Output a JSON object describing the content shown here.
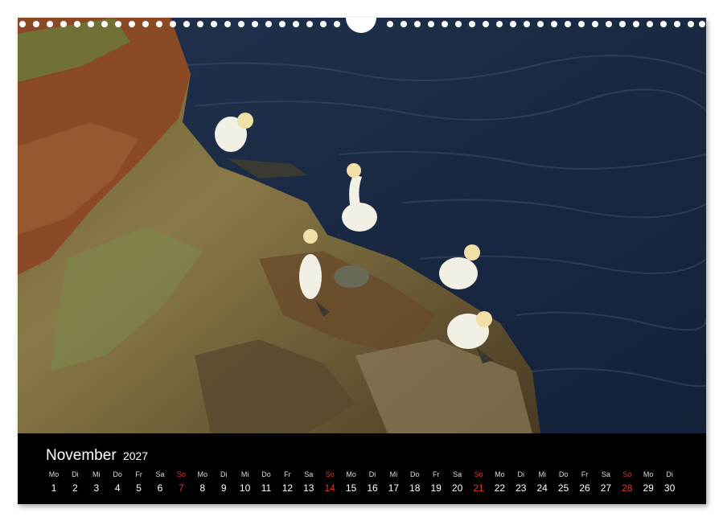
{
  "calendar": {
    "month": "November",
    "year": "2027",
    "days": [
      {
        "wd": "Mo",
        "n": "1"
      },
      {
        "wd": "Di",
        "n": "2"
      },
      {
        "wd": "Mi",
        "n": "3"
      },
      {
        "wd": "Do",
        "n": "4"
      },
      {
        "wd": "Fr",
        "n": "5"
      },
      {
        "wd": "Sa",
        "n": "6"
      },
      {
        "wd": "So",
        "n": "7",
        "sunday": true
      },
      {
        "wd": "Mo",
        "n": "8"
      },
      {
        "wd": "Di",
        "n": "9"
      },
      {
        "wd": "Mi",
        "n": "10"
      },
      {
        "wd": "Do",
        "n": "11"
      },
      {
        "wd": "Fr",
        "n": "12"
      },
      {
        "wd": "Sa",
        "n": "13"
      },
      {
        "wd": "So",
        "n": "14",
        "sunday": true
      },
      {
        "wd": "Mo",
        "n": "15"
      },
      {
        "wd": "Di",
        "n": "16"
      },
      {
        "wd": "Mi",
        "n": "17"
      },
      {
        "wd": "Do",
        "n": "18"
      },
      {
        "wd": "Fr",
        "n": "19"
      },
      {
        "wd": "Sa",
        "n": "20"
      },
      {
        "wd": "So",
        "n": "21",
        "sunday": true
      },
      {
        "wd": "Mo",
        "n": "22"
      },
      {
        "wd": "Di",
        "n": "23"
      },
      {
        "wd": "Mi",
        "n": "24"
      },
      {
        "wd": "Do",
        "n": "25"
      },
      {
        "wd": "Fr",
        "n": "26"
      },
      {
        "wd": "Sa",
        "n": "27"
      },
      {
        "wd": "So",
        "n": "28",
        "sunday": true
      },
      {
        "wd": "Mo",
        "n": "29"
      },
      {
        "wd": "Di",
        "n": "30"
      }
    ]
  },
  "colors": {
    "sunday": "#e0342b",
    "calendar_bg": "#000000",
    "sea": "#1b2a44"
  }
}
